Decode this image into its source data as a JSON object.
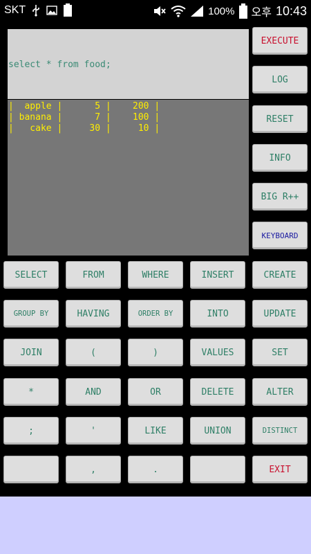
{
  "status_bar": {
    "carrier": "SKT",
    "usb_icon": "usb-icon",
    "gallery_icon": "image-icon",
    "battery_small_label": "100",
    "mute_icon": "mute-icon",
    "wifi_icon": "wifi-icon",
    "signal_icon": "signal-icon",
    "battery_percent": "100%",
    "ampm": "오후",
    "time": "10:43"
  },
  "editor": {
    "query": "select * from food;",
    "results": [
      "|  apple |      5 |    200 |",
      "| banana |      7 |    100 |",
      "|   cake |     30 |     10 |"
    ]
  },
  "side_buttons": {
    "execute": "EXECUTE",
    "log": "LOG",
    "reset": "RESET",
    "info": "INFO",
    "bigr": "BIG R++",
    "keyboard": "KEYBOARD"
  },
  "keys": {
    "row1": [
      "SELECT",
      "FROM",
      "WHERE",
      "INSERT",
      "CREATE"
    ],
    "row2": [
      "GROUP BY",
      "HAVING",
      "ORDER BY",
      "INTO",
      "UPDATE"
    ],
    "row3": [
      "JOIN",
      "(",
      ")",
      "VALUES",
      "SET"
    ],
    "row4": [
      "*",
      "AND",
      "OR",
      "DELETE",
      "ALTER"
    ],
    "row5": [
      ";",
      "'",
      "LIKE",
      "UNION",
      "DISTINCT"
    ],
    "row6": [
      "",
      ",",
      ".",
      "",
      "EXIT"
    ]
  },
  "colors": {
    "button_text": "#2e7f66",
    "accent_red": "#c8102e",
    "accent_blue": "#1a1aa0",
    "result_text": "#ffee00",
    "query_bg": "#d3d3d3",
    "result_bg": "#777777",
    "bottom_panel": "#cfcfff"
  }
}
